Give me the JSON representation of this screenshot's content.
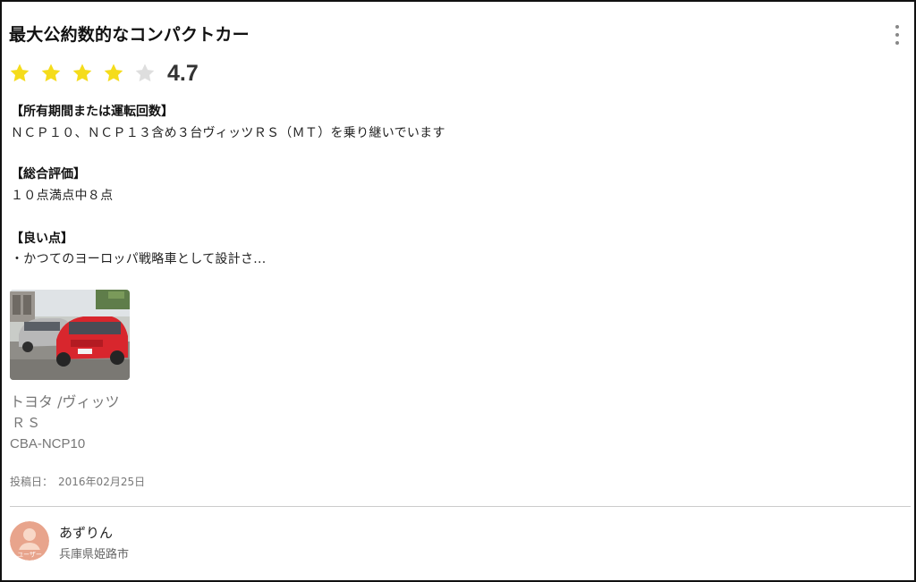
{
  "review": {
    "title": "最大公約数的なコンパクトカー",
    "rating": {
      "value": "4.7",
      "stars_filled": 4,
      "stars_total": 5
    },
    "sections": [
      {
        "label": "【所有期間または運転回数】",
        "text": "ＮＣＰ１０、ＮＣＰ１３含め３台ヴィッツＲＳ（ＭＴ）を乗り継いでいます"
      },
      {
        "label": "【総合評価】",
        "text": "１０点満点中８点"
      },
      {
        "label": "【良い点】",
        "text": "・かつてのヨーロッパ戦略車として設計さ..."
      }
    ]
  },
  "car": {
    "photo_icon": "car-photo",
    "maker_model": "トヨタ /ヴィッツ",
    "grade": "ＲＳ",
    "model_code": "CBA-NCP10"
  },
  "post": {
    "label": "投稿日：",
    "date": "2016年02月25日"
  },
  "user": {
    "name": "あずりん",
    "location": "兵庫県姫路市",
    "avatar_label": "ユーザー"
  },
  "colors": {
    "star_filled": "#f5dc1b",
    "star_empty": "#dedede",
    "avatar_bg": "#e8a48c",
    "avatar_figure": "#f8d8c8"
  },
  "icons": {
    "menu": "more-vertical-icon",
    "star": "star-icon"
  }
}
